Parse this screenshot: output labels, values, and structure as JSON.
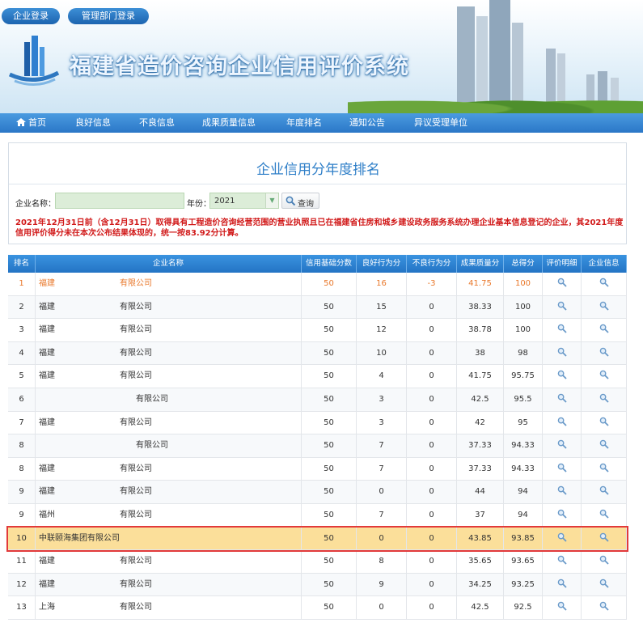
{
  "header": {
    "company_login": "企业登录",
    "dept_login": "管理部门登录",
    "site_title": "福建省造价咨询企业信用评价系统"
  },
  "nav": [
    {
      "label": "首页",
      "icon": "home-icon"
    },
    {
      "label": "良好信息"
    },
    {
      "label": "不良信息"
    },
    {
      "label": "成果质量信息"
    },
    {
      "label": "年度排名"
    },
    {
      "label": "通知公告"
    },
    {
      "label": "异议受理单位"
    }
  ],
  "search": {
    "title": "企业信用分年度排名",
    "company_label": "企业名称：",
    "company_value": "",
    "year_label": "年份：",
    "year_value": "2021",
    "query_label": "查询",
    "query_icon": "search-icon",
    "notice": "2021年12月31日前（含12月31日）取得具有工程造价咨询经营范围的营业执照且已在福建省住房和城乡建设政务服务系统办理企业基本信息登记的企业，其2021年度信用评价得分未在本次公布结果体现的，统一按83.92分计算。"
  },
  "table": {
    "headers": [
      "排名",
      "企业名称",
      "信用基础分数",
      "良好行为分",
      "不良行为分",
      "成果质量分",
      "总得分",
      "评价明细",
      "企业信息"
    ],
    "detail_icon": "magnifier-icon",
    "rows": [
      {
        "rank": "1",
        "prefix": "福建",
        "suffix": "有限公司",
        "base": "50",
        "good": "16",
        "bad": "-3",
        "quality": "41.75",
        "total": "100"
      },
      {
        "rank": "2",
        "prefix": "福建",
        "suffix": "有限公司",
        "base": "50",
        "good": "15",
        "bad": "0",
        "quality": "38.33",
        "total": "100"
      },
      {
        "rank": "3",
        "prefix": "福建",
        "suffix": "有限公司",
        "base": "50",
        "good": "12",
        "bad": "0",
        "quality": "38.78",
        "total": "100"
      },
      {
        "rank": "4",
        "prefix": "福建",
        "suffix": "有限公司",
        "base": "50",
        "good": "10",
        "bad": "0",
        "quality": "38",
        "total": "98"
      },
      {
        "rank": "5",
        "prefix": "福建",
        "suffix": "有限公司",
        "base": "50",
        "good": "4",
        "bad": "0",
        "quality": "41.75",
        "total": "95.75"
      },
      {
        "rank": "6",
        "prefix": "",
        "suffix": "有限公司",
        "base": "50",
        "good": "3",
        "bad": "0",
        "quality": "42.5",
        "total": "95.5"
      },
      {
        "rank": "7",
        "prefix": "福建",
        "suffix": "有限公司",
        "base": "50",
        "good": "3",
        "bad": "0",
        "quality": "42",
        "total": "95"
      },
      {
        "rank": "8",
        "prefix": "",
        "suffix": "有限公司",
        "base": "50",
        "good": "7",
        "bad": "0",
        "quality": "37.33",
        "total": "94.33"
      },
      {
        "rank": "8",
        "prefix": "福建",
        "suffix": "有限公司",
        "base": "50",
        "good": "7",
        "bad": "0",
        "quality": "37.33",
        "total": "94.33"
      },
      {
        "rank": "9",
        "prefix": "福建",
        "suffix": "有限公司",
        "base": "50",
        "good": "0",
        "bad": "0",
        "quality": "44",
        "total": "94"
      },
      {
        "rank": "9",
        "prefix": "福州",
        "suffix": "有限公司",
        "base": "50",
        "good": "7",
        "bad": "0",
        "quality": "37",
        "total": "94"
      },
      {
        "rank": "10",
        "prefix": "中联颐海集团有限公司",
        "suffix": "",
        "base": "50",
        "good": "0",
        "bad": "0",
        "quality": "43.85",
        "total": "93.85"
      },
      {
        "rank": "11",
        "prefix": "福建",
        "suffix": "有限公司",
        "base": "50",
        "good": "8",
        "bad": "0",
        "quality": "35.65",
        "total": "93.65"
      },
      {
        "rank": "12",
        "prefix": "福建",
        "suffix": "有限公司",
        "base": "50",
        "good": "9",
        "bad": "0",
        "quality": "34.25",
        "total": "93.25"
      },
      {
        "rank": "13",
        "prefix": "上海",
        "suffix": "有限公司",
        "base": "50",
        "good": "0",
        "bad": "0",
        "quality": "42.5",
        "total": "92.5"
      }
    ]
  }
}
